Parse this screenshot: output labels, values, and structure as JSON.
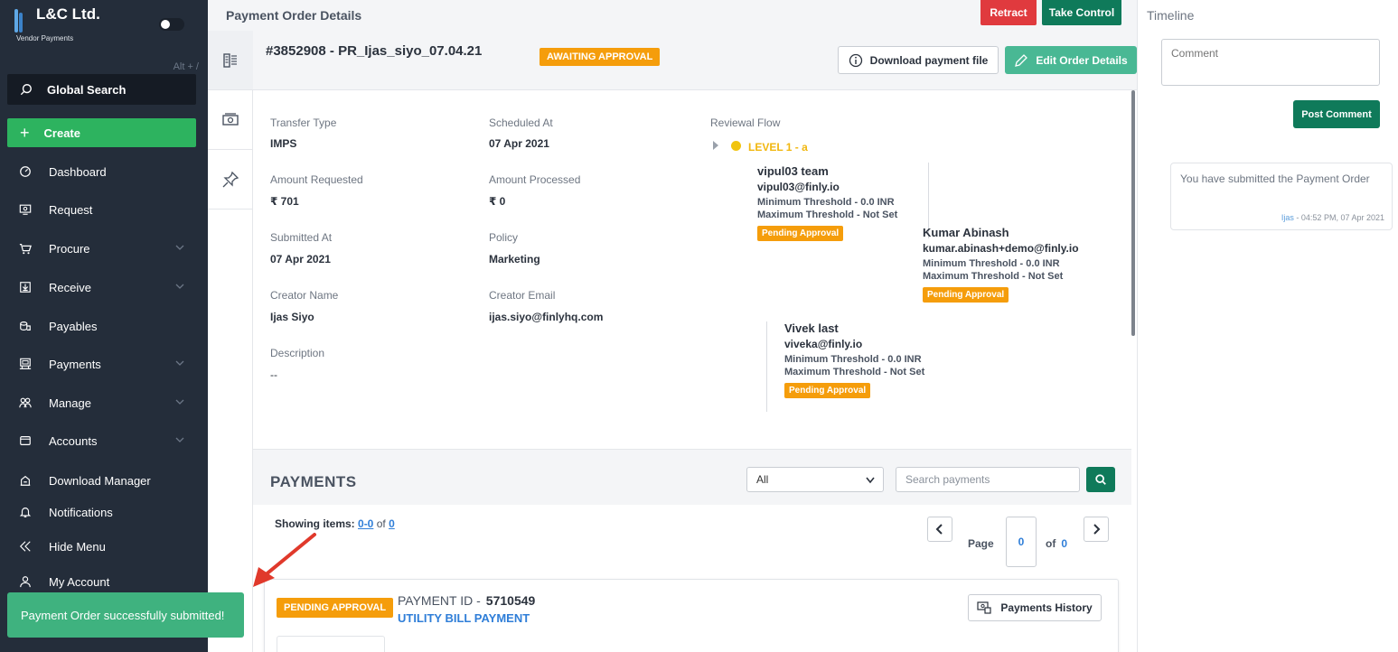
{
  "sidebar": {
    "brand_name": "L&C Ltd.",
    "brand_sub": "Vendor Payments",
    "alt_hint": "Alt + /",
    "search_label": "Global Search",
    "create_label": "Create",
    "items": [
      {
        "label": "Dashboard",
        "icon": "dashboard-icon"
      },
      {
        "label": "Request",
        "icon": "request-icon"
      },
      {
        "label": "Procure",
        "icon": "cart-icon"
      },
      {
        "label": "Receive",
        "icon": "receive-icon"
      },
      {
        "label": "Payables",
        "icon": "coins-icon"
      },
      {
        "label": "Payments",
        "icon": "payments-icon"
      },
      {
        "label": "Manage",
        "icon": "users-icon"
      },
      {
        "label": "Accounts",
        "icon": "folder-icon"
      },
      {
        "label": "Download Manager",
        "icon": "download-manager-icon"
      },
      {
        "label": "Notifications",
        "icon": "bell-icon"
      },
      {
        "label": "Hide Menu",
        "icon": "double-chevron-left-icon"
      },
      {
        "label": "My Account",
        "icon": "user-icon"
      }
    ]
  },
  "toast": {
    "message": "Payment Order successfully submitted!"
  },
  "header": {
    "title": "Payment Order Details",
    "retract_label": "Retract",
    "take_control_label": "Take Control"
  },
  "order": {
    "title": "#3852908  -  PR_Ijas_siyo_07.04.21",
    "status": "AWAITING APPROVAL",
    "download_label": "Download payment file",
    "edit_label": "Edit Order Details"
  },
  "details": {
    "transfer_type_label": "Transfer Type",
    "transfer_type": "IMPS",
    "scheduled_label": "Scheduled At",
    "scheduled": "07 Apr 2021",
    "amount_req_label": "Amount Requested",
    "amount_req": "₹ 701",
    "amount_proc_label": "Amount Processed",
    "amount_proc": "₹ 0",
    "submitted_label": "Submitted At",
    "submitted": "07 Apr 2021",
    "policy_label": "Policy",
    "policy": "Marketing",
    "creator_name_label": "Creator Name",
    "creator_name": "Ijas Siyo",
    "creator_email_label": "Creator Email",
    "creator_email": "ijas.siyo@finlyhq.com",
    "description_label": "Description",
    "description": "--"
  },
  "review": {
    "label": "Reviewal Flow",
    "level": "LEVEL 1  -  a",
    "approvers": [
      {
        "name": "vipul03 team",
        "email": "vipul03@finly.io",
        "min": "Minimum Threshold -  0.0 INR",
        "max": "Maximum Threshold -  Not Set",
        "status": "Pending Approval"
      },
      {
        "name": "Kumar Abinash",
        "email": "kumar.abinash+demo@finly.io",
        "min": "Minimum Threshold -  0.0 INR",
        "max": "Maximum Threshold -  Not Set",
        "status": "Pending Approval"
      },
      {
        "name": "Vivek last",
        "email": "viveka@finly.io",
        "min": "Minimum Threshold -  0.0 INR",
        "max": "Maximum Threshold -  Not Set",
        "status": "Pending Approval"
      }
    ]
  },
  "payments": {
    "title": "PAYMENTS",
    "filter_value": "All",
    "search_placeholder": "Search payments",
    "showing_label": "Showing items:",
    "showing_range": "0-0",
    "showing_of": "of",
    "showing_total": "0",
    "page_label": "Page",
    "page_current": "0",
    "page_of": "of",
    "page_total": "0",
    "card": {
      "status": "PENDING APPROVAL",
      "id_label": "PAYMENT ID  -",
      "id": "5710549",
      "type": "UTILITY BILL PAYMENT",
      "history_label": "Payments History"
    }
  },
  "timeline": {
    "title": "Timeline",
    "comment_placeholder": "Comment",
    "post_label": "Post Comment",
    "entry_message": "You have submitted the Payment Order",
    "entry_user": "Ijas",
    "entry_time": " - 04:52 PM, 07 Apr 2021"
  },
  "colors": {
    "sidebar_bg": "#242d3a",
    "create_green": "#2db35f",
    "primary_green": "#0f7a5a",
    "retract_red": "#e03a3e",
    "status_orange": "#f59d0b",
    "link_blue": "#2f7ed8",
    "toast_green": "#3fb27f",
    "arrow_red": "#e0392b"
  }
}
